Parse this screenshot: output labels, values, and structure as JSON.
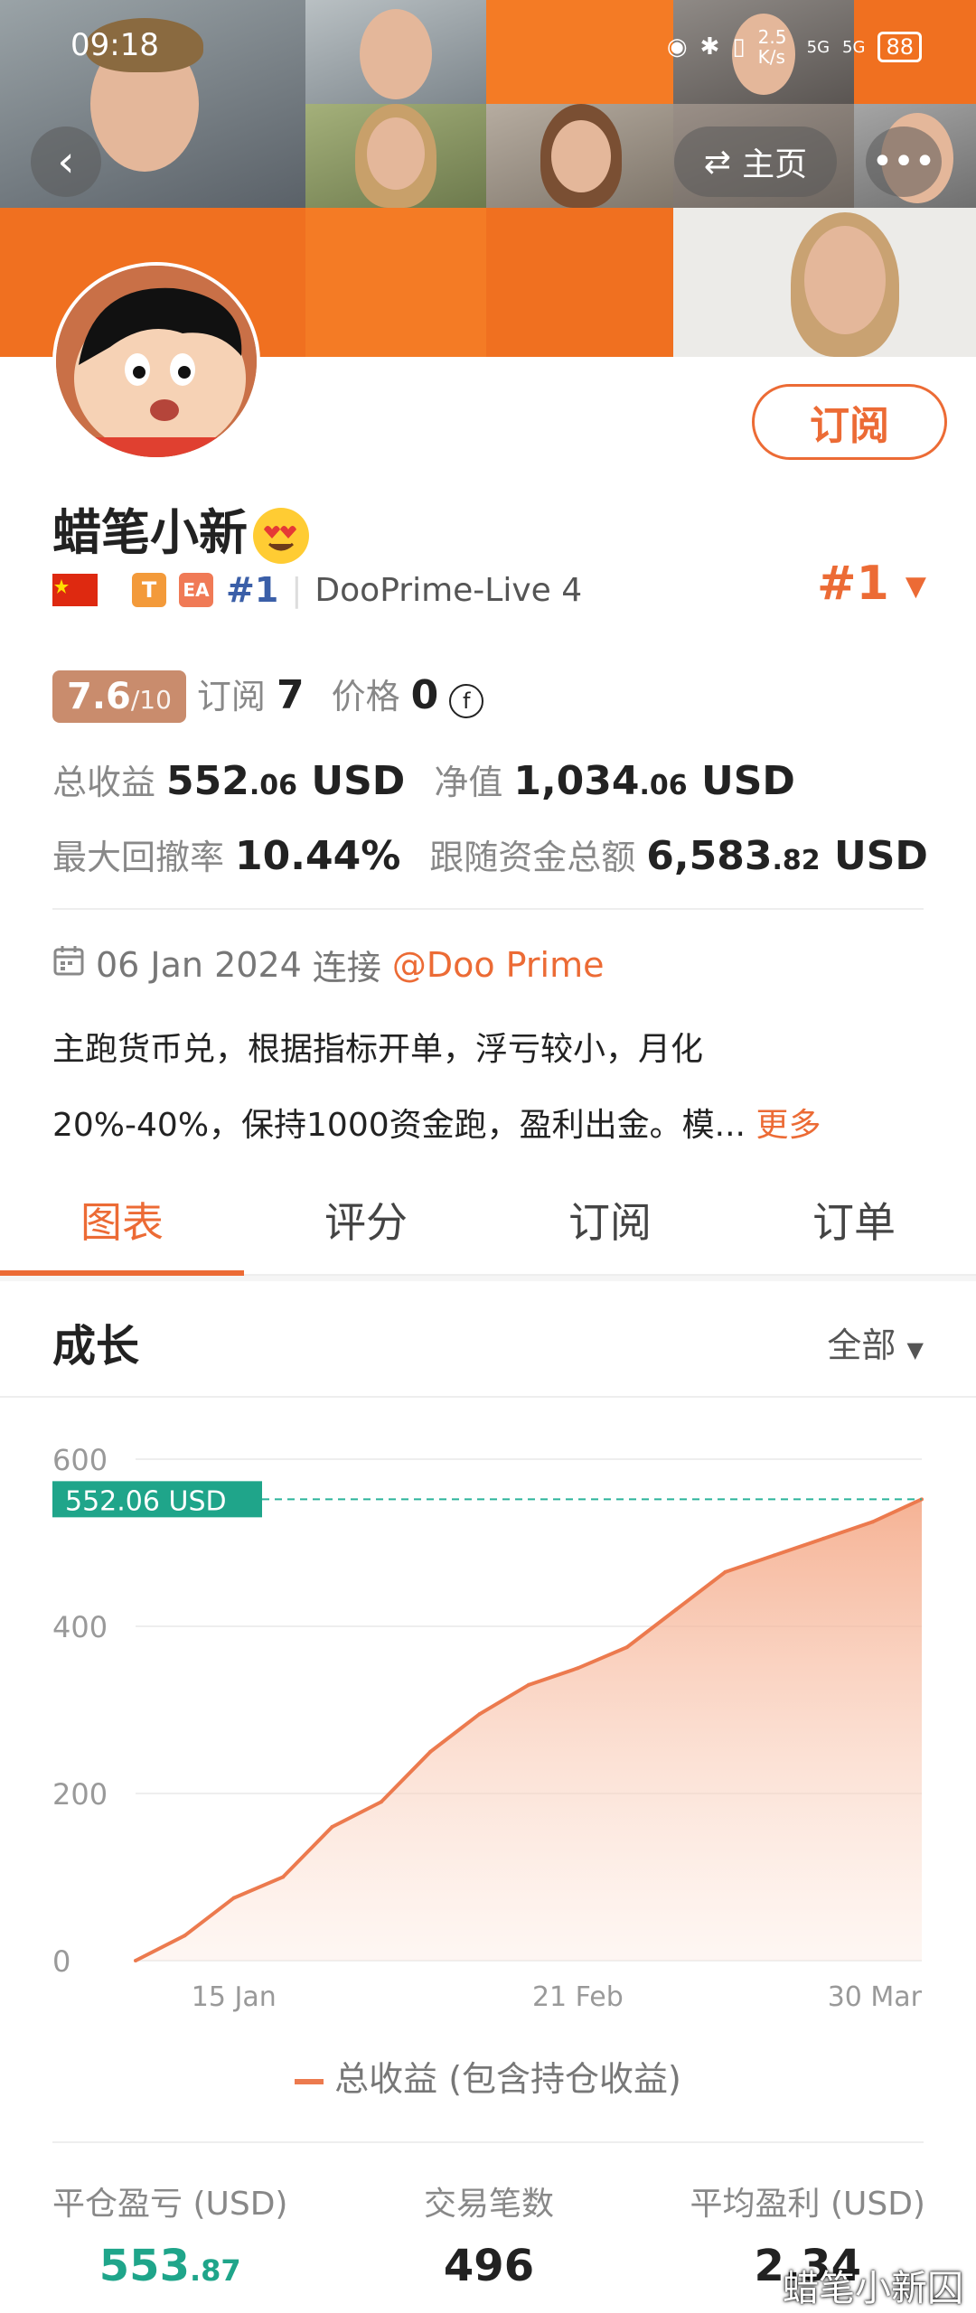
{
  "status_bar": {
    "time": "09:18",
    "net_speed": "2.5 K/s",
    "signal1": "5G",
    "signal2": "5G",
    "battery": "88"
  },
  "nav": {
    "home_label": "主页"
  },
  "profile": {
    "name": "蜡笔小新",
    "tags": {
      "t": "T",
      "ea": "EA",
      "rank": "#1",
      "server": "DooPrime-Live 4"
    },
    "rank_right": "#1",
    "subscribe_label": "订阅",
    "score": "7.6",
    "score_max": "/10",
    "subs_label": "订阅",
    "subs_value": "7",
    "price_label": "价格",
    "price_value": "0",
    "total_profit_label": "总收益",
    "total_profit_int": "552",
    "total_profit_dec": ".06",
    "total_profit_unit": "USD",
    "equity_label": "净值",
    "equity_int": "1,034",
    "equity_dec": ".06",
    "equity_unit": "USD",
    "drawdown_label": "最大回撤率",
    "drawdown_value": "10.44%",
    "follow_label": "跟随资金总额",
    "follow_int": "6,583",
    "follow_dec": ".82",
    "follow_unit": "USD",
    "date": "06 Jan 2024",
    "connect_label": "连接",
    "broker_link": "@Doo Prime",
    "desc_line1": "主跑货币兑，根据指标开单，浮亏较小，月化",
    "desc_line2": "20%-40%，保持1000资金跑，盈利出金。模...",
    "more_label": "更多"
  },
  "tabs": [
    {
      "label": "图表"
    },
    {
      "label": "评分"
    },
    {
      "label": "订阅"
    },
    {
      "label": "订单"
    }
  ],
  "growth": {
    "title": "成长",
    "filter": "全部"
  },
  "chart_data": {
    "type": "area",
    "series": [
      {
        "name": "总收益 (包含持仓收益)",
        "x": [
          "06 Jan",
          "10 Jan",
          "15 Jan",
          "20 Jan",
          "26 Jan",
          "01 Feb",
          "07 Feb",
          "12 Feb",
          "16 Feb",
          "21 Feb",
          "26 Feb",
          "03 Mar",
          "08 Mar",
          "13 Mar",
          "18 Mar",
          "23 Mar",
          "30 Mar"
        ],
        "values": [
          0,
          30,
          75,
          100,
          160,
          190,
          250,
          295,
          330,
          350,
          375,
          420,
          465,
          485,
          505,
          525,
          552.06
        ]
      }
    ],
    "x_ticks": [
      "15 Jan",
      "21 Feb",
      "30 Mar"
    ],
    "y_ticks": [
      0,
      200,
      400,
      600
    ],
    "ylim": [
      0,
      600
    ],
    "last_label": "552.06 USD",
    "color": "#ec7a4e"
  },
  "stats": [
    {
      "label": "平仓盈亏 (USD)",
      "value_int": "553",
      "value_dec": ".87"
    },
    {
      "label": "交易笔数",
      "value_int": "496",
      "value_dec": ""
    },
    {
      "label": "平均盈利 (USD)",
      "value_int": "2.34",
      "value_dec": ""
    }
  ],
  "watermark": "蜡笔小新囚"
}
